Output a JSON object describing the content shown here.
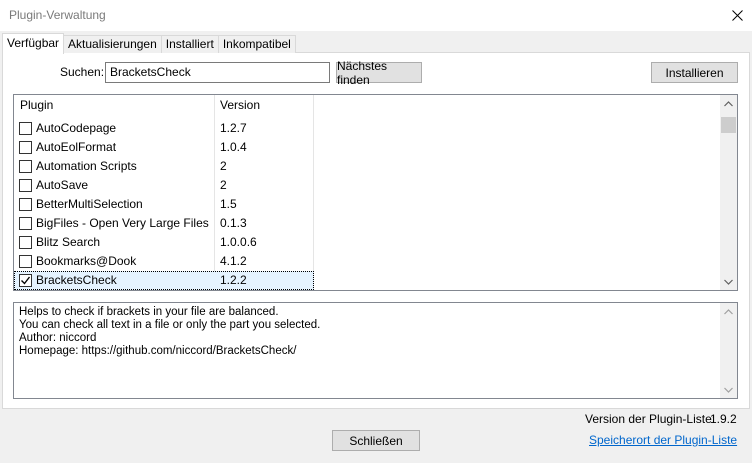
{
  "window": {
    "title": "Plugin-Verwaltung"
  },
  "tabs": [
    {
      "label": "Verfügbar",
      "active": true
    },
    {
      "label": "Aktualisierungen",
      "active": false
    },
    {
      "label": "Installiert",
      "active": false
    },
    {
      "label": "Inkompatibel",
      "active": false
    }
  ],
  "search": {
    "label": "Suchen:",
    "value": "BracketsCheck",
    "next_button": "Nächstes finden"
  },
  "install_button": "Installieren",
  "list": {
    "columns": [
      "Plugin",
      "Version"
    ],
    "rows": [
      {
        "name": "AutoCodepage",
        "version": "1.2.7",
        "checked": false
      },
      {
        "name": "AutoEolFormat",
        "version": "1.0.4",
        "checked": false
      },
      {
        "name": "Automation Scripts",
        "version": "2",
        "checked": false
      },
      {
        "name": "AutoSave",
        "version": "2",
        "checked": false
      },
      {
        "name": "BetterMultiSelection",
        "version": "1.5",
        "checked": false
      },
      {
        "name": "BigFiles - Open Very Large Files",
        "version": "0.1.3",
        "checked": false
      },
      {
        "name": "Blitz Search",
        "version": "1.0.0.6",
        "checked": false
      },
      {
        "name": "Bookmarks@Dook",
        "version": "4.1.2",
        "checked": false
      },
      {
        "name": "BracketsCheck",
        "version": "1.2.2",
        "checked": true
      }
    ]
  },
  "description": {
    "lines": [
      "Helps to check if brackets in your file are balanced.",
      "You can check all text in a file or only the part you selected.",
      "Author: niccord",
      "Homepage: https://github.com/niccord/BracketsCheck/"
    ]
  },
  "footer": {
    "version_label": "Version der Plugin-Liste:",
    "version_value": "1.9.2",
    "close_button": "Schließen",
    "link": "Speicherort der Plugin-Liste"
  },
  "colors": {
    "link": "#0066cc",
    "selected_row": "#e5f3ff"
  }
}
